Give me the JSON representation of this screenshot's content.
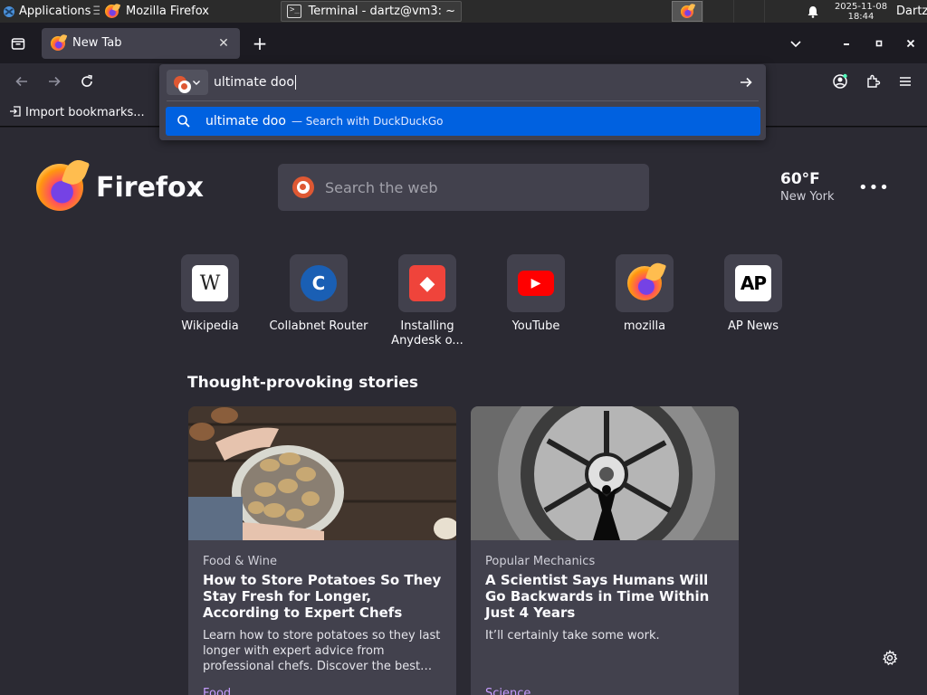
{
  "taskbar": {
    "applications_label": "Applications",
    "firefox_task": "Mozilla Firefox",
    "terminal_task": "Terminal - dartz@vm3: ~",
    "terminal_glyph": ">_",
    "date": "2025-11-08",
    "time": "18:44",
    "user": "Dartz"
  },
  "tab": {
    "title": "New Tab"
  },
  "urlbar": {
    "value": "ultimate doo",
    "suggestion_text": "ultimate doo",
    "suggestion_sub": "— Search with DuckDuckGo"
  },
  "bookmarks": {
    "import_label": "Import bookmarks..."
  },
  "newtab": {
    "brand": "Firefox",
    "search_placeholder": "Search the web",
    "weather": {
      "temp": "60°F",
      "location": "New York"
    },
    "top_sites": [
      {
        "label": "Wikipedia",
        "icon": "W",
        "bg": "#ffffff",
        "fg": "#222222"
      },
      {
        "label": "Collabnet Router",
        "icon": "C",
        "bg": "#1a5fb4",
        "fg": "#ffffff"
      },
      {
        "label": "Installing Anydesk o...",
        "icon": "◆",
        "bg": "#ef443b",
        "fg": "#ffffff"
      },
      {
        "label": "YouTube",
        "icon": "▶",
        "bg": "#ff0000",
        "fg": "#ffffff"
      },
      {
        "label": "mozilla",
        "icon": "",
        "bg": "transparent",
        "fg": "#ffffff"
      },
      {
        "label": "AP News",
        "icon": "AP",
        "bg": "#ffffff",
        "fg": "#000000"
      }
    ],
    "stories_heading": "Thought-provoking stories",
    "stories": [
      {
        "source": "Food & Wine",
        "title": "How to Store Potatoes So They Stay Fresh for Longer, According to Expert Chefs",
        "excerpt": "Learn how to store potatoes so they last longer with expert advice from professional chefs. Discover the best…",
        "category": "Food"
      },
      {
        "source": "Popular Mechanics",
        "title": "A Scientist Says Humans Will Go Backwards in Time Within Just 4 Years",
        "excerpt": "It’ll certainly take some work.",
        "category": "Science"
      }
    ]
  },
  "colors": {
    "accent": "#0061e0",
    "page_bg": "#2b2a33",
    "card_bg": "#42414d"
  }
}
